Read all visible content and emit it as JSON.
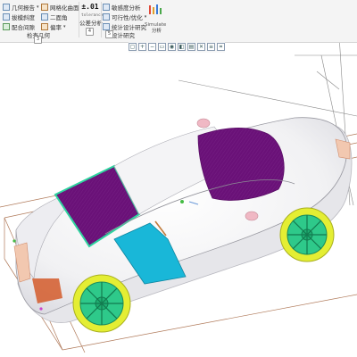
{
  "ribbon": {
    "inspect_geometry": {
      "items": [
        {
          "label": "几何报告",
          "icon": "geometry-report-icon",
          "has_menu": true
        },
        {
          "label": "网格化曲面",
          "icon": "mesh-surface-icon",
          "has_menu": false
        },
        {
          "label": "拔模斜度",
          "icon": "draft-icon",
          "has_menu": false
        },
        {
          "label": "二面角",
          "icon": "dihedral-angle-icon",
          "has_menu": false
        },
        {
          "label": "配合间隙",
          "icon": "fit-clearance-icon",
          "has_menu": false
        },
        {
          "label": "偏率",
          "icon": "deviation-icon",
          "has_menu": true
        }
      ],
      "group_label": "检查几何",
      "group_key": "3"
    },
    "tolerance": {
      "big_label_top": "±.01",
      "big_label_sub": "tolerance",
      "group_label": "公差分析",
      "group_key": "4"
    },
    "design_study": {
      "items": [
        {
          "label": "敏感度分析",
          "icon": "sensitivity-icon"
        },
        {
          "label": "可行性/优化",
          "icon": "feasibility-icon",
          "has_menu": true
        },
        {
          "label": "统计设计研究",
          "icon": "statistical-study-icon"
        }
      ],
      "simulate_label": "Simulate",
      "simulate_sub": "分析",
      "group_label": "设计研究",
      "group_key": "5"
    }
  },
  "view_toolbar": [
    {
      "name": "refit-icon",
      "glyph": "▢"
    },
    {
      "name": "zoom-in-icon",
      "glyph": "+"
    },
    {
      "name": "zoom-out-icon",
      "glyph": "−"
    },
    {
      "name": "repaint-icon",
      "glyph": "▭"
    },
    {
      "name": "spin-center-icon",
      "glyph": "◉"
    },
    {
      "name": "display-style-icon",
      "glyph": "◧"
    },
    {
      "name": "saved-views-icon",
      "glyph": "▤"
    },
    {
      "name": "datum-display-icon",
      "glyph": "✕"
    },
    {
      "name": "annotation-display-icon",
      "glyph": "≡"
    },
    {
      "name": "section-icon",
      "glyph": "⌗"
    }
  ],
  "colors": {
    "ribbon_bg": "#f4f4f4",
    "body": "#f3f3f5",
    "windows": "#6a1178",
    "side_window": "#19b7d8",
    "wheel_rim": "#2ec98a",
    "tire": "#e4ee33",
    "bbox_lines": "#b07a5a"
  }
}
